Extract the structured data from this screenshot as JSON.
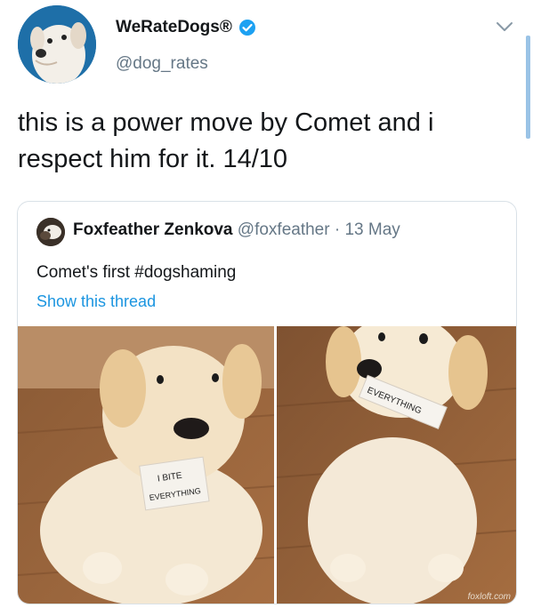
{
  "account": {
    "name": "WeRateDogs®",
    "handle": "@dog_rates"
  },
  "tweet": {
    "text": "this is a power move by Comet and i respect him for it. 14/10"
  },
  "quoted": {
    "name": "Foxfeather Zenkova",
    "handle": "@foxfeather",
    "separator": "·",
    "date": "13 May",
    "text": "Comet's first #dogshaming",
    "thread_link": "Show this thread",
    "sign_line1": "I BITE",
    "sign_line2": "EVERYTHING",
    "mouth_sign": "EVERYTHING",
    "watermark": "foxloft.com"
  },
  "icons": {
    "verified": "verified-badge-icon",
    "chevron": "chevron-down-icon"
  },
  "colors": {
    "link": "#1b95e0",
    "verified": "#1da1f2",
    "secondary_text": "#657786"
  }
}
